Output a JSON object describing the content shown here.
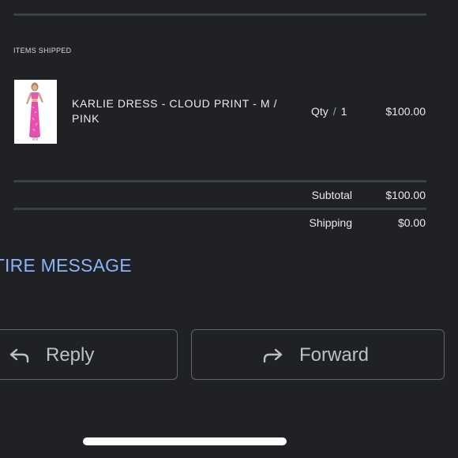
{
  "order": {
    "section_label": "ITEMS SHIPPED",
    "item": {
      "name": "KARLIE DRESS - CLOUD PRINT - M / PINK",
      "qty_label": "Qty",
      "qty_separator": "/",
      "qty_value": "1",
      "price": "$100.00",
      "image_icon": "pink-dress-photo"
    },
    "summary": {
      "subtotal_label": "Subtotal",
      "subtotal_value": "$100.00",
      "shipping_label": "Shipping",
      "shipping_value": "$0.00"
    }
  },
  "message": {
    "view_entire_label": "NTIRE MESSAGE"
  },
  "actions": {
    "reply_label": "Reply",
    "reply_icon": "reply-arrow-icon",
    "forward_label": "Forward",
    "forward_icon": "forward-arrow-icon"
  },
  "colors": {
    "background": "#202124",
    "link": "#8ab4f8",
    "divider": "#3c4043",
    "button_border": "#5f6368"
  }
}
